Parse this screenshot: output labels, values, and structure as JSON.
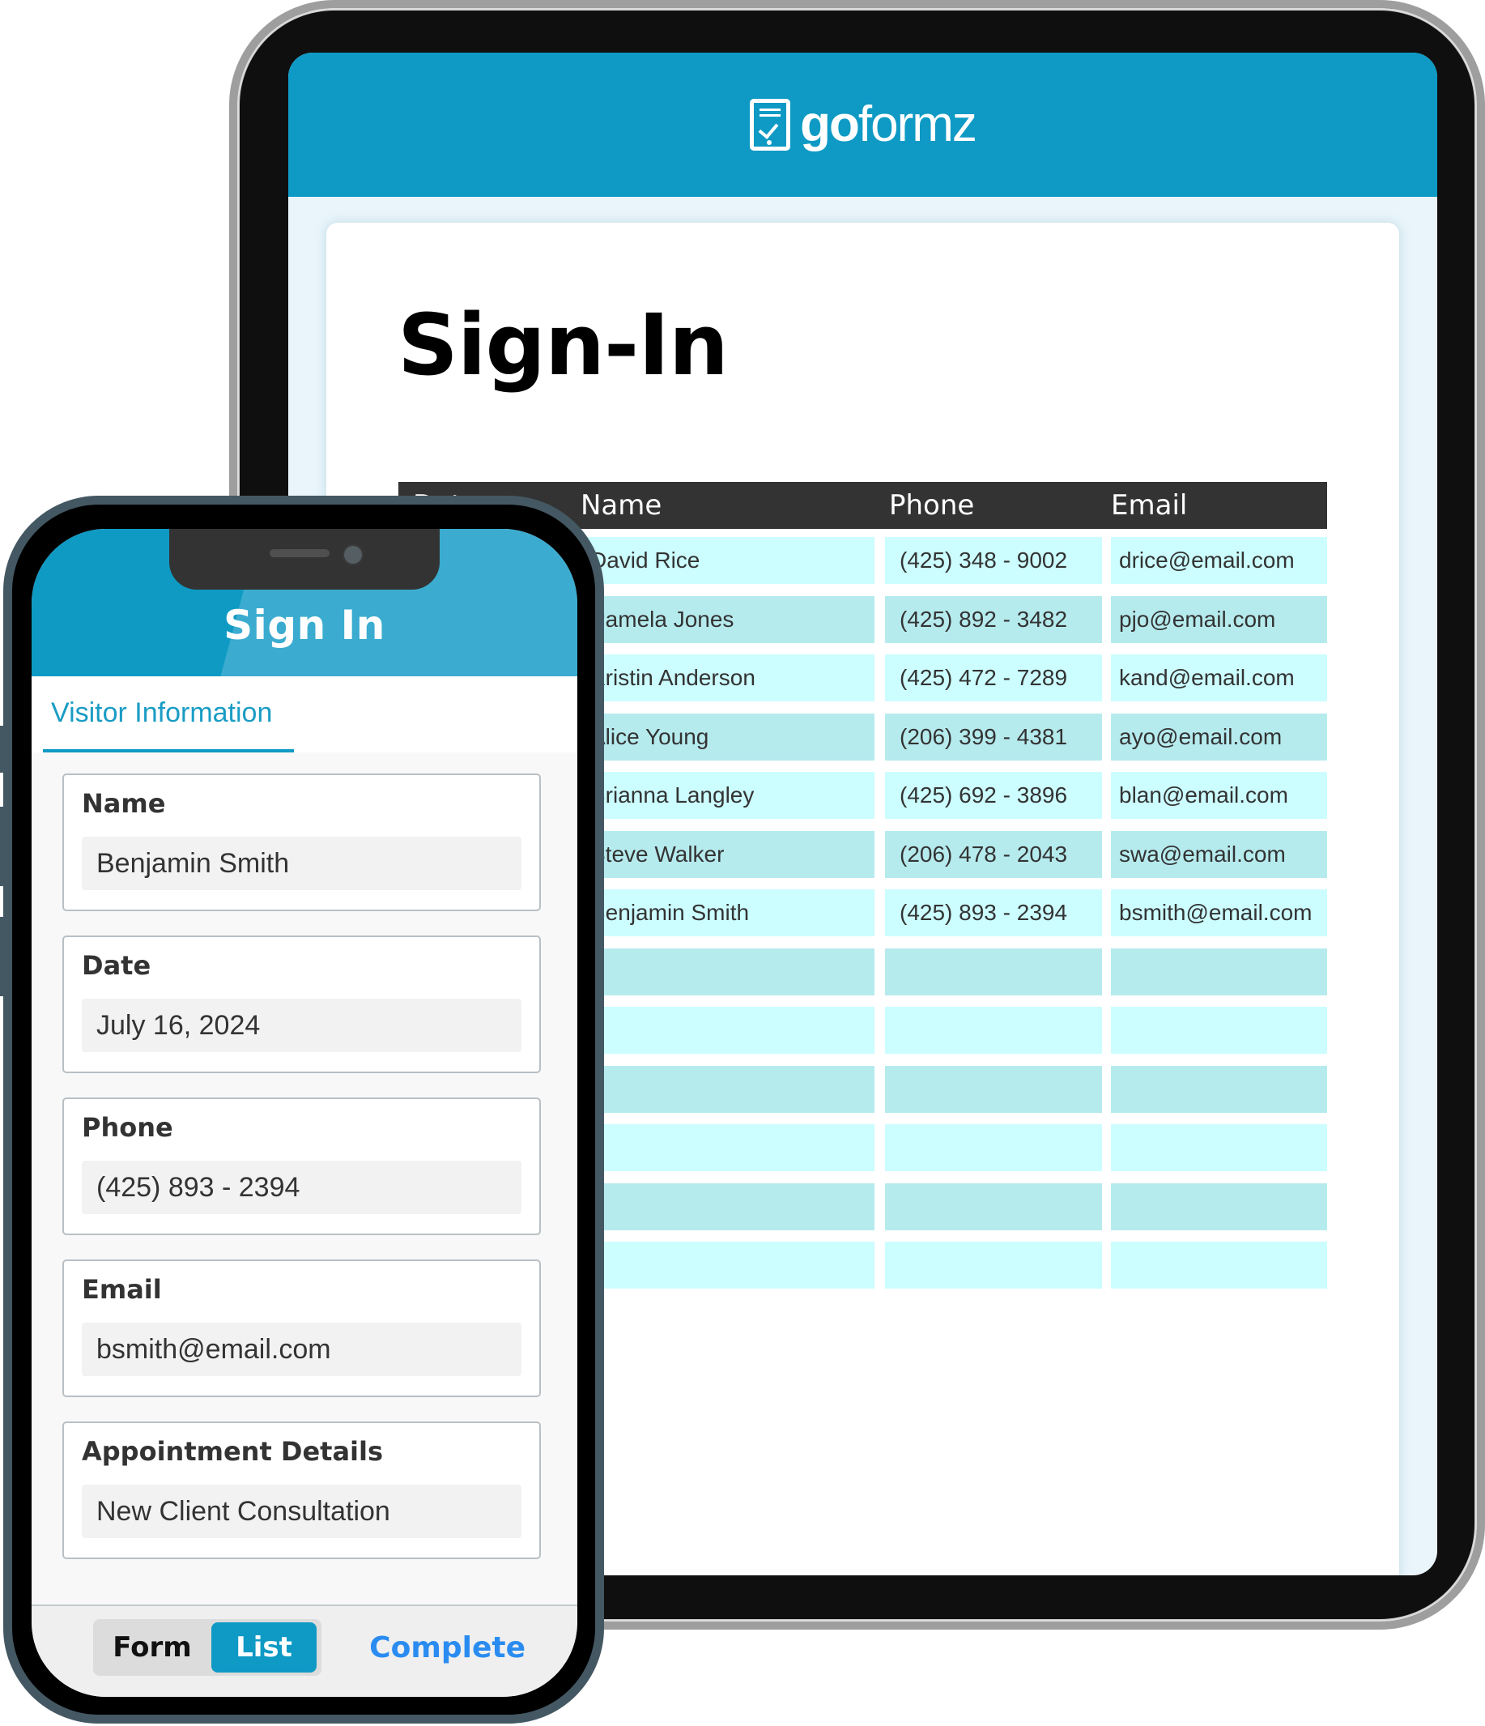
{
  "tablet": {
    "brand": {
      "bold": "go",
      "light": "formz",
      "icon": "tablet-checklist-icon"
    },
    "document_title": "Sign-In",
    "table": {
      "columns": [
        "Date",
        "Name",
        "Phone",
        "Email"
      ],
      "rows": [
        {
          "date": "",
          "name": "David Rice",
          "phone": "(425) 348 - 9002",
          "email": "drice@email.com"
        },
        {
          "date": "",
          "name": "Pamela Jones",
          "phone": "(425) 892 - 3482",
          "email": "pjo@email.com"
        },
        {
          "date": "",
          "name": "Kristin Anderson",
          "phone": "(425) 472 - 7289",
          "email": "kand@email.com"
        },
        {
          "date": "",
          "name": "Alice Young",
          "phone": "(206) 399 - 4381",
          "email": "ayo@email.com"
        },
        {
          "date": "",
          "name": "Brianna Langley",
          "phone": "(425) 692 - 3896",
          "email": "blan@email.com"
        },
        {
          "date": "",
          "name": "Steve Walker",
          "phone": "(206) 478 - 2043",
          "email": "swa@email.com"
        },
        {
          "date": "",
          "name": "Benjamin Smith",
          "phone": "(425) 893 - 2394",
          "email": "bsmith@email.com"
        },
        {
          "date": "",
          "name": "",
          "phone": "",
          "email": ""
        },
        {
          "date": "",
          "name": "",
          "phone": "",
          "email": ""
        },
        {
          "date": "",
          "name": "",
          "phone": "",
          "email": ""
        },
        {
          "date": "",
          "name": "",
          "phone": "",
          "email": ""
        },
        {
          "date": "",
          "name": "",
          "phone": "",
          "email": ""
        },
        {
          "date": "",
          "name": "",
          "phone": "",
          "email": ""
        }
      ]
    }
  },
  "phone": {
    "title": "Sign In",
    "active_tab": "Visitor Information",
    "fields": [
      {
        "label": "Name",
        "value": "Benjamin Smith"
      },
      {
        "label": "Date",
        "value": "July 16, 2024"
      },
      {
        "label": "Phone",
        "value": "(425) 893 - 2394"
      },
      {
        "label": "Email",
        "value": "bsmith@email.com"
      },
      {
        "label": "Appointment Details",
        "value": "New Client Consultation"
      }
    ],
    "bottom_bar": {
      "form_label": "Form",
      "list_label": "List",
      "selected_view": "List",
      "complete_label": "Complete"
    }
  },
  "colors": {
    "brand_blue": "#0e9ac4",
    "table_header": "#333333",
    "row_light": "#ccfdff",
    "row_dark": "#b6ebee",
    "complete_link": "#2a8cf0"
  }
}
